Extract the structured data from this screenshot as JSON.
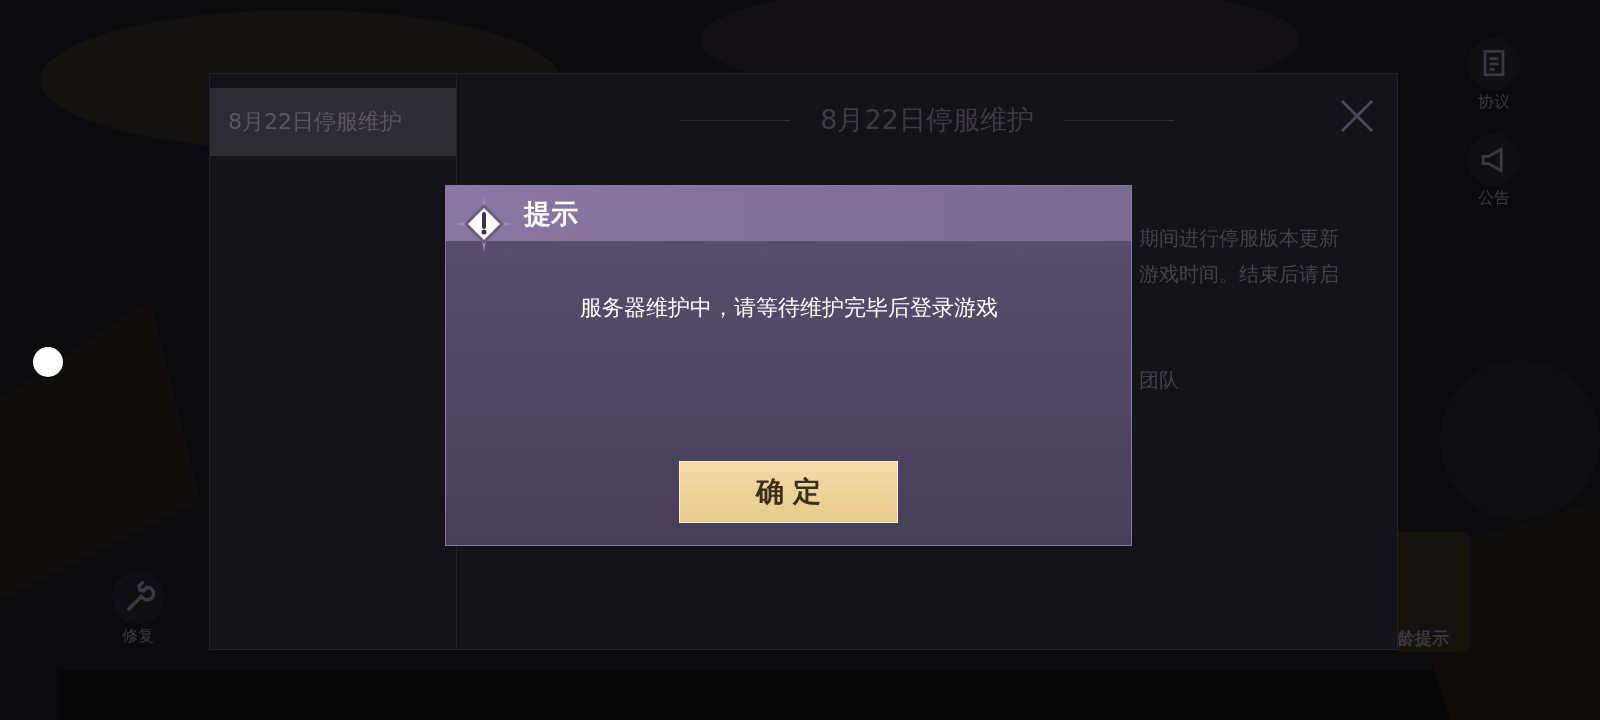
{
  "notice_panel": {
    "tabs": [
      {
        "label": "8月22日停服维护",
        "selected": true
      }
    ],
    "heading": "8月22日停服维护",
    "body_lines": [
      "期间进行停服版本更新",
      "游戏时间。结束后请启",
      "团队"
    ]
  },
  "right_buttons": [
    {
      "label": "协议",
      "kind": "document"
    },
    {
      "label": "公告",
      "kind": "megaphone"
    }
  ],
  "left_buttons": [
    {
      "label": "修复",
      "kind": "wrench"
    }
  ],
  "age_rating": {
    "label": "龄提示"
  },
  "dialog": {
    "title": "提示",
    "message": "服务器维护中，请等待维护完毕后登录游戏",
    "button": "确 定"
  }
}
